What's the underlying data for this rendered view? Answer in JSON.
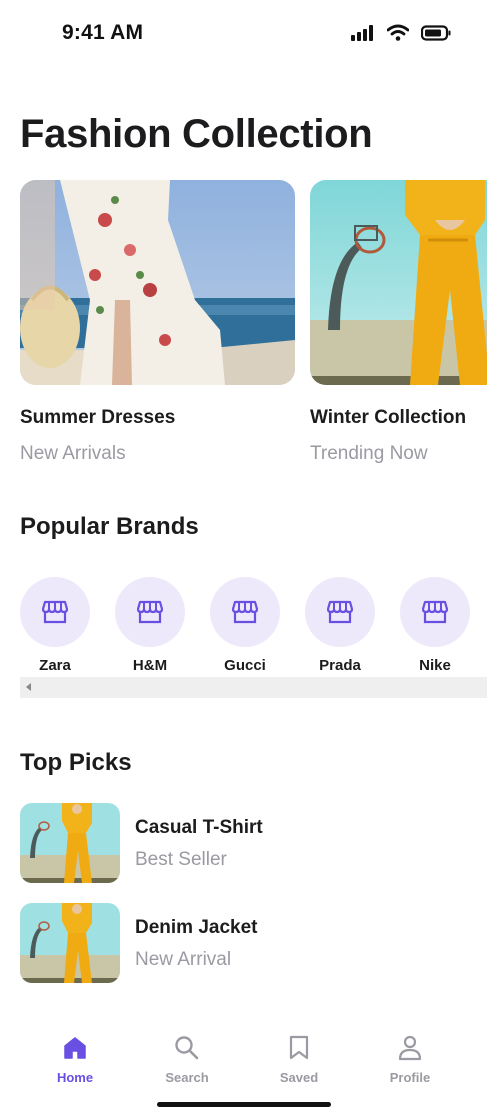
{
  "status_bar": {
    "time": "9:41 AM"
  },
  "page_title": "Fashion Collection",
  "featured": [
    {
      "title": "Summer Dresses",
      "subtitle": "New Arrivals"
    },
    {
      "title": "Winter Collection",
      "subtitle": "Trending Now"
    }
  ],
  "brands_section": {
    "title": "Popular Brands",
    "icon": "storefront-icon",
    "items": [
      {
        "label": "Zara"
      },
      {
        "label": "H&M"
      },
      {
        "label": "Gucci"
      },
      {
        "label": "Prada"
      },
      {
        "label": "Nike"
      }
    ]
  },
  "top_picks": {
    "title": "Top Picks",
    "items": [
      {
        "title": "Casual T-Shirt",
        "subtitle": "Best Seller"
      },
      {
        "title": "Denim Jacket",
        "subtitle": "New Arrival"
      }
    ]
  },
  "tab_bar": {
    "tabs": [
      {
        "label": "Home",
        "icon": "home-icon",
        "active": true
      },
      {
        "label": "Search",
        "icon": "search-icon",
        "active": false
      },
      {
        "label": "Saved",
        "icon": "bookmark-icon",
        "active": false
      },
      {
        "label": "Profile",
        "icon": "profile-icon",
        "active": false
      }
    ]
  },
  "colors": {
    "accent": "#6a4fe3",
    "brand_circle": "#ede9fb",
    "muted_text": "#9a9aa2",
    "primary_text": "#1c1c1e"
  }
}
